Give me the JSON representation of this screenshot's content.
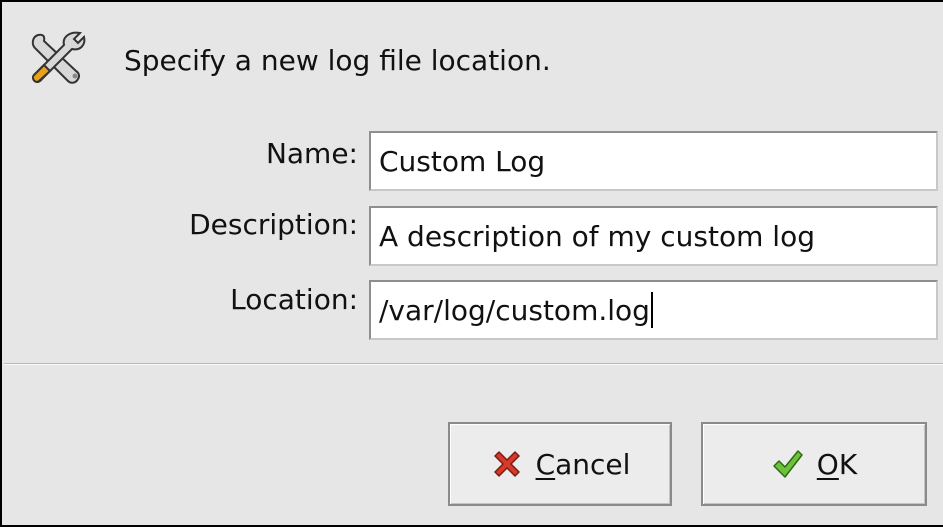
{
  "dialog": {
    "header_icon": "tools-icon",
    "prompt": "Specify a new log file location."
  },
  "fields": [
    {
      "label": "Name:",
      "value": "Custom Log"
    },
    {
      "label": "Description:",
      "value": "A description of my custom log"
    },
    {
      "label": "Location:",
      "value": "/var/log/custom.log"
    }
  ],
  "buttons": {
    "cancel": {
      "mnemonic": "C",
      "rest": "ancel",
      "icon": "cancel-x-icon"
    },
    "ok": {
      "mnemonic": "O",
      "rest": "K",
      "icon": "checkmark-icon"
    }
  },
  "colors": {
    "cancel_icon": "#d63a2a",
    "ok_icon": "#4a9a1e",
    "tool_handle": "#e8a21a"
  }
}
